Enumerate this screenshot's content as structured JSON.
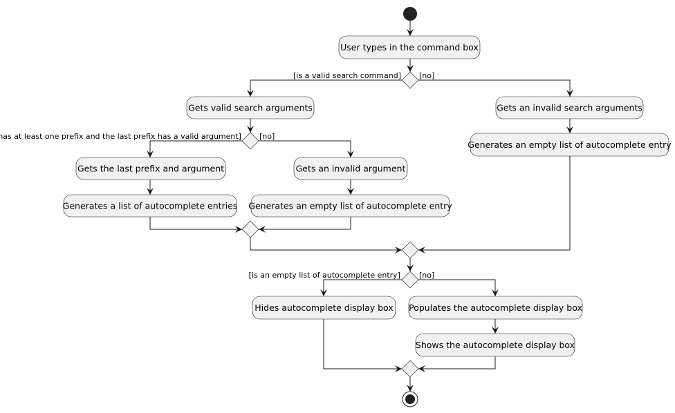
{
  "diagram": {
    "type": "activity",
    "colors": {
      "node_fill": "#f1f1f1",
      "stroke": "#181818",
      "start": "#222222"
    },
    "actions": {
      "user_types": "User types in the command box",
      "valid_args": "Gets valid search arguments",
      "invalid_search_args": "Gets an invalid search arguments",
      "empty_list_right": "Generates an empty list of autocomplete entry",
      "last_prefix": "Gets the last prefix and argument",
      "invalid_arg": "Gets an invalid argument",
      "list_entries": "Generates a list of autocomplete entries",
      "empty_list_mid": "Generates an empty list of autocomplete entry",
      "hides": "Hides autocomplete display box",
      "populates": "Populates the autocomplete display box",
      "shows": "Shows the autocomplete display box"
    },
    "guards": {
      "valid_cmd_yes": "[is a valid search command]",
      "valid_cmd_no": "[no]",
      "prefix_yes": "[has at least one prefix and the last prefix has a valid argument]",
      "prefix_no": "[no]",
      "empty_yes": "[is an empty list of autocomplete entry]",
      "empty_no": "[no]"
    }
  }
}
